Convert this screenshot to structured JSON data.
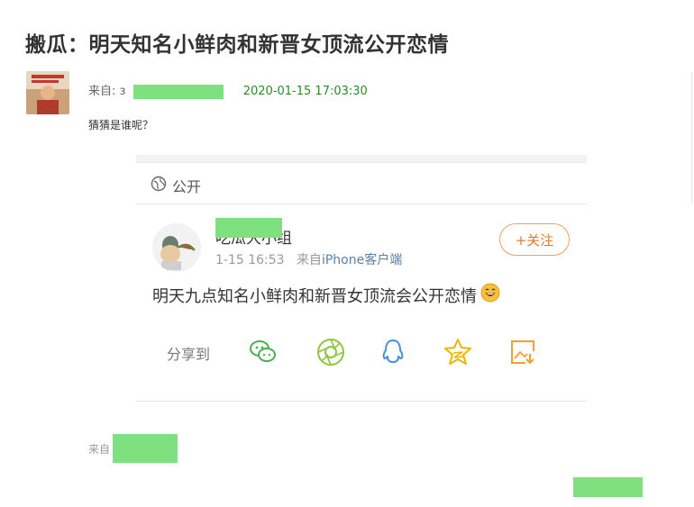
{
  "post": {
    "title": "搬瓜：明天知名小鲜肉和新晋女顶流公开恋情",
    "from_label": "来自:",
    "from_partial": "з",
    "timestamp": "2020-01-15 17:03:30",
    "body": "猜猜是谁呢？"
  },
  "card": {
    "scope": "公开",
    "author_name": "吃瓜大小组",
    "post_time": "1-15 16:53",
    "source_prefix": "来自",
    "source_client": "iPhone客户端",
    "follow_label": "+关注",
    "text": "明天九点知名小鲜肉和新晋女顶流会公开恋情",
    "share_label": "分享到",
    "share_icons": [
      "wechat-icon",
      "moments-icon",
      "qq-icon",
      "qzone-icon",
      "save-image-icon"
    ]
  },
  "footer": {
    "source_label": "来自"
  },
  "colors": {
    "accent_green": "#2a8a2a",
    "redaction": "#7fe07f",
    "follow_orange": "#e07b2a"
  }
}
